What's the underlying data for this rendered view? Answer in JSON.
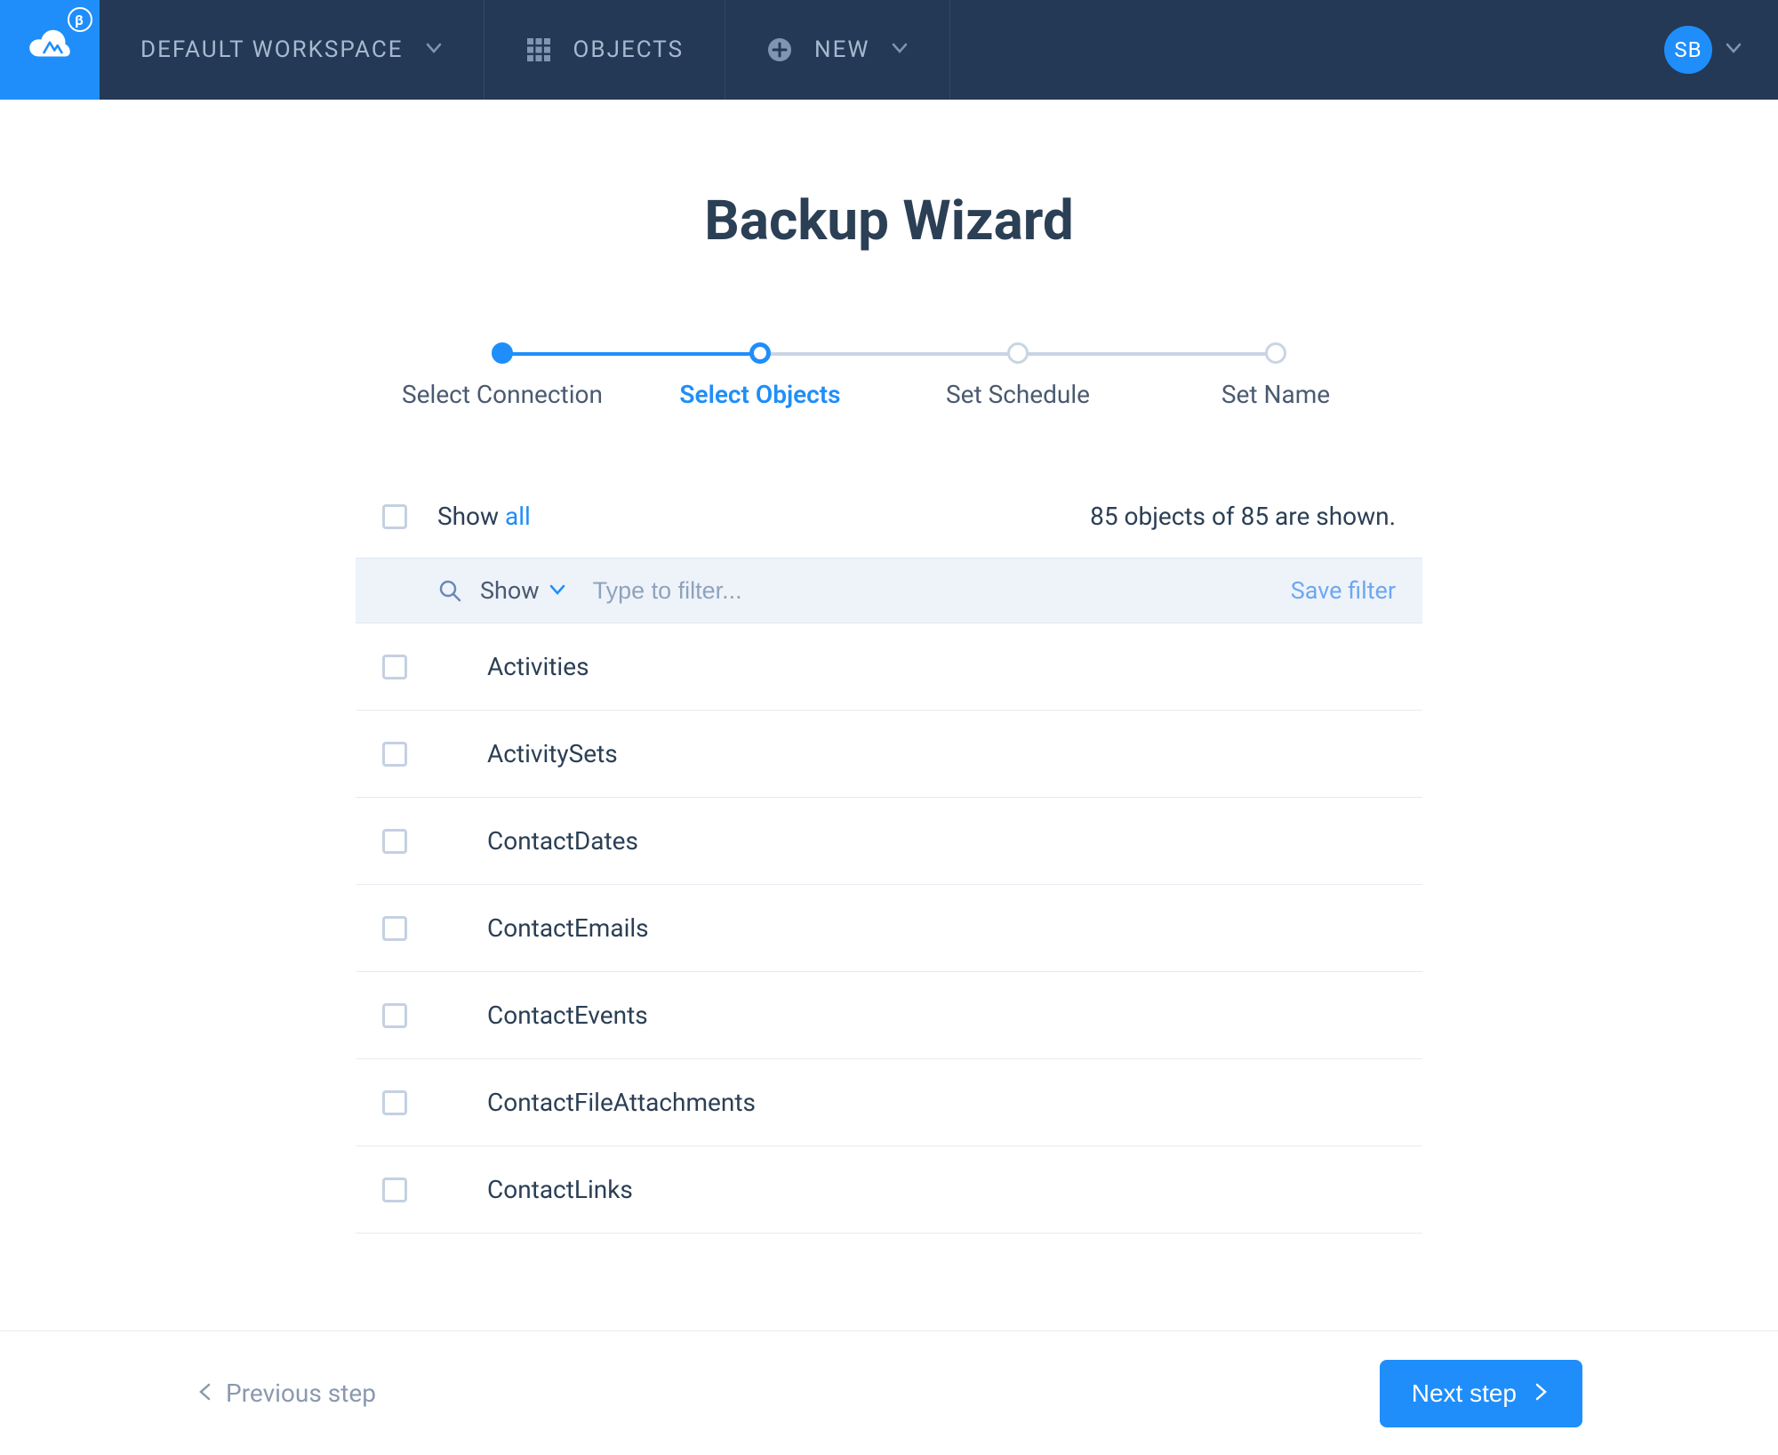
{
  "header": {
    "workspace_label": "DEFAULT WORKSPACE",
    "objects_label": "OBJECTS",
    "new_label": "NEW",
    "avatar_initials": "SB",
    "beta_badge": "β"
  },
  "page": {
    "title": "Backup Wizard"
  },
  "stepper": {
    "steps": [
      {
        "label": "Select Connection"
      },
      {
        "label": "Select Objects"
      },
      {
        "label": "Set Schedule"
      },
      {
        "label": "Set Name"
      }
    ]
  },
  "list": {
    "show_word": "Show ",
    "show_scope": "all",
    "count_text": "85 objects of 85 are shown.",
    "filter_show_label": "Show",
    "filter_placeholder": "Type to filter...",
    "save_filter_label": "Save filter",
    "objects": [
      "Activities",
      "ActivitySets",
      "ContactDates",
      "ContactEmails",
      "ContactEvents",
      "ContactFileAttachments",
      "ContactLinks"
    ]
  },
  "footer": {
    "prev_label": "Previous step",
    "next_label": "Next step"
  }
}
